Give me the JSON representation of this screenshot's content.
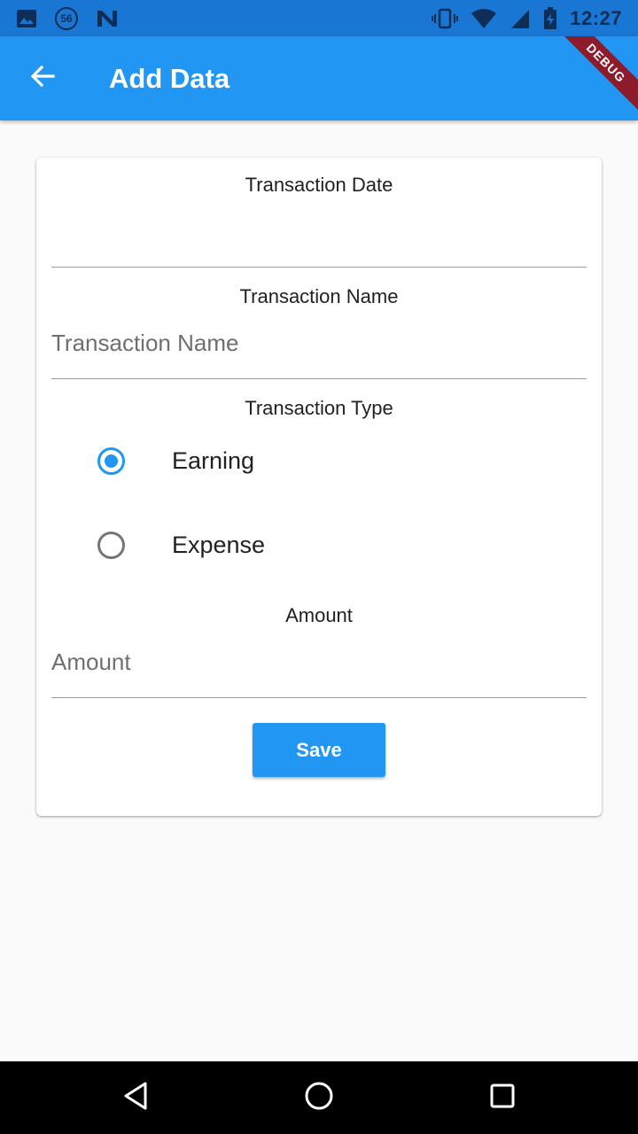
{
  "status_bar": {
    "time": "12:27",
    "left_icons": [
      "image-icon",
      "badge-56-icon",
      "n-icon"
    ],
    "right_icons": [
      "vibrate-icon",
      "wifi-icon",
      "signal-icon",
      "battery-charging-icon"
    ],
    "badge_text": "56",
    "n_text": "N"
  },
  "app_bar": {
    "title": "Add Data",
    "back_icon": "arrow-back-icon",
    "debug_label": "DEBUG",
    "color": "#2196f3"
  },
  "form": {
    "date": {
      "label": "Transaction Date",
      "value": ""
    },
    "name": {
      "label": "Transaction Name",
      "placeholder": "Transaction Name",
      "value": ""
    },
    "type": {
      "label": "Transaction Type",
      "options": [
        {
          "label": "Earning",
          "selected": true
        },
        {
          "label": "Expense",
          "selected": false
        }
      ]
    },
    "amount": {
      "label": "Amount",
      "placeholder": "Amount",
      "value": ""
    },
    "save_label": "Save"
  },
  "nav_bar": {
    "buttons": [
      "back-triangle-icon",
      "home-circle-icon",
      "recents-square-icon"
    ]
  }
}
